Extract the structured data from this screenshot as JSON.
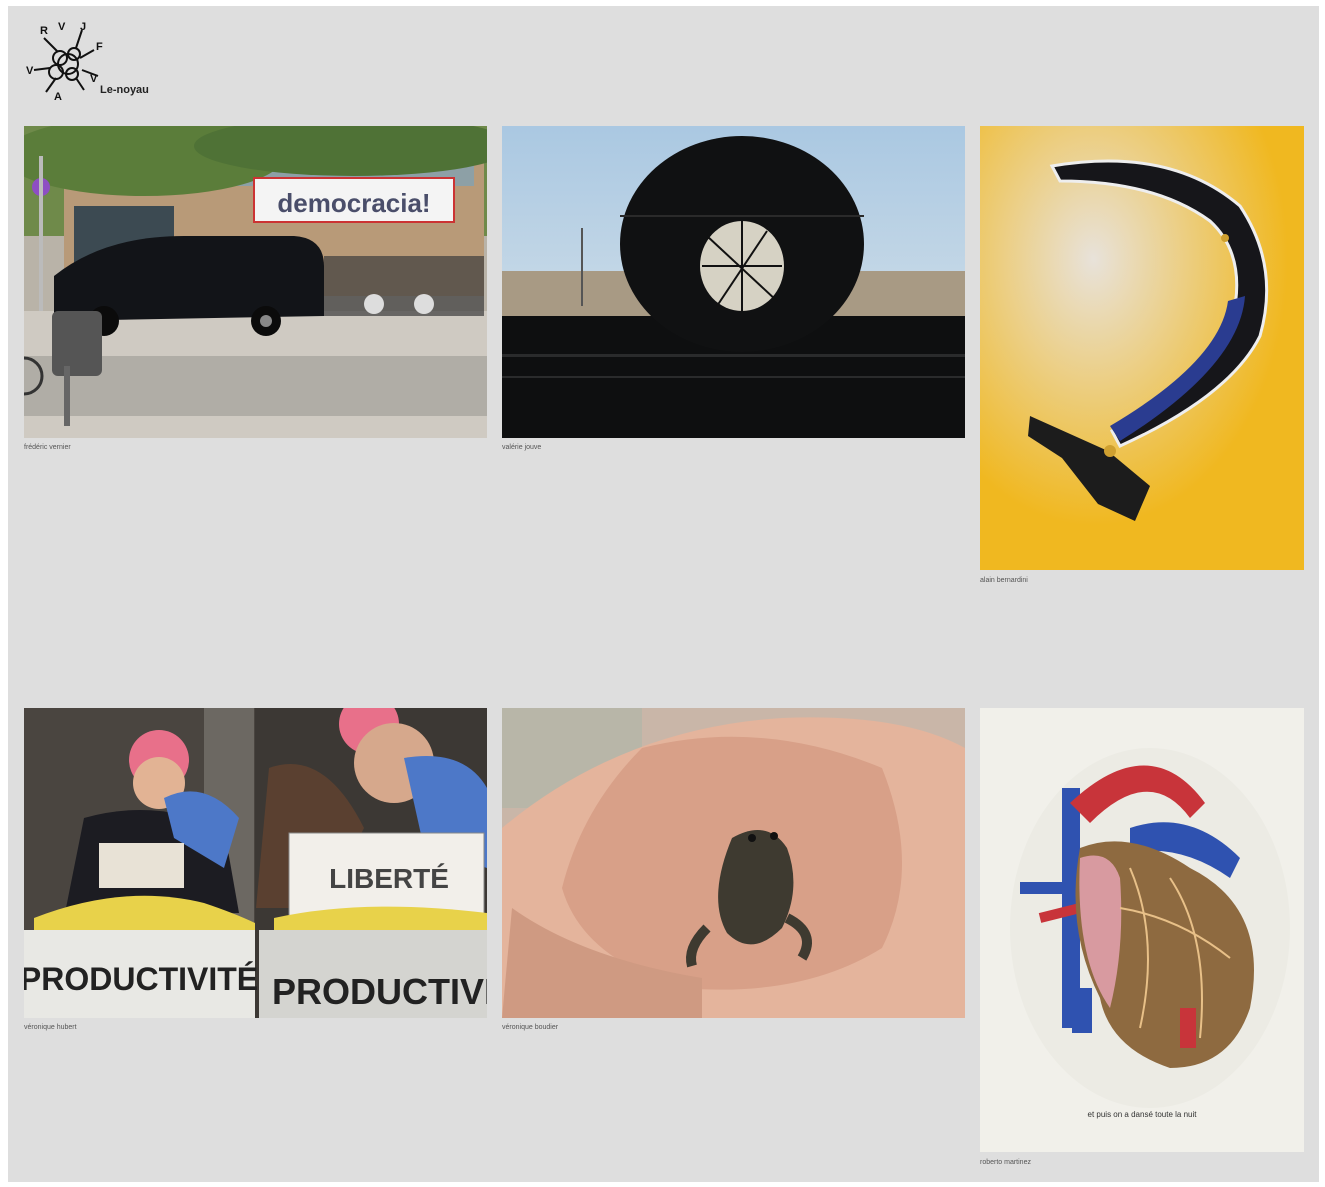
{
  "site": {
    "name": "Le-noyau"
  },
  "logo": {
    "icon": "nucleus-logo-icon",
    "letters": [
      "R",
      "J",
      "V",
      "F",
      "V",
      "V",
      "A"
    ]
  },
  "gallery": [
    {
      "author": "frédéric vernier",
      "sign_text": "democracia!",
      "icon": "street-van-photo"
    },
    {
      "author": "valérie jouve",
      "icon": "pipe-landscape-photo"
    },
    {
      "author": "alain bernardini",
      "icon": "sickle-hammer-object-photo"
    },
    {
      "author": "véronique hubert",
      "texts": [
        "LIBERTÉ",
        "PRODUCTIVITÉ",
        "PRODUCTIVIT"
      ],
      "icon": "protest-sign-photo"
    },
    {
      "author": "véronique boudier",
      "icon": "frog-in-hand-photo"
    },
    {
      "author": "roberto martinez",
      "image_caption": "et puis on a dansé toute la nuit",
      "icon": "anatomical-heart-illustration"
    }
  ],
  "colors": {
    "background": "#dedede",
    "yellow_bg": "#f0b820",
    "blue_handle": "#2a3c90"
  }
}
